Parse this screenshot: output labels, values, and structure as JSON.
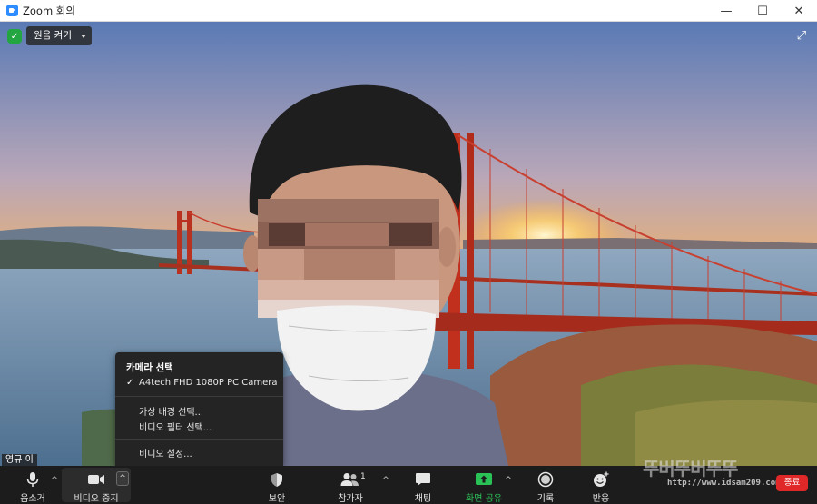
{
  "window": {
    "title": "Zoom 회의",
    "minimize": "—",
    "maximize": "☐",
    "close": "✕"
  },
  "overlay": {
    "original_sound": "원음 켜기",
    "fullscreen": "⤢",
    "participant_name": "영규 이"
  },
  "camera_menu": {
    "section_title": "카메라 선택",
    "check": "✓",
    "camera_device": "A4tech FHD 1080P PC Camera",
    "virtual_bg": "가상 배경 선택...",
    "video_filter": "비디오 필터 선택...",
    "video_settings": "비디오 설정..."
  },
  "toolbar": {
    "mute": "음소거",
    "stop_video": "비디오 중지",
    "security": "보안",
    "participants": "참가자",
    "participants_count": "1",
    "chat": "채팅",
    "share_screen": "화면 공유",
    "record": "기록",
    "reactions": "반응",
    "end": "종료",
    "caret": "^"
  },
  "watermark": {
    "text": "뚜버뚜버뚜뚜",
    "url": "http://www.idsam209.com"
  },
  "colors": {
    "accent_green": "#2ac157",
    "end_red": "#e02828",
    "toolbar_bg": "#1c1c1c",
    "menu_bg": "#242424"
  }
}
